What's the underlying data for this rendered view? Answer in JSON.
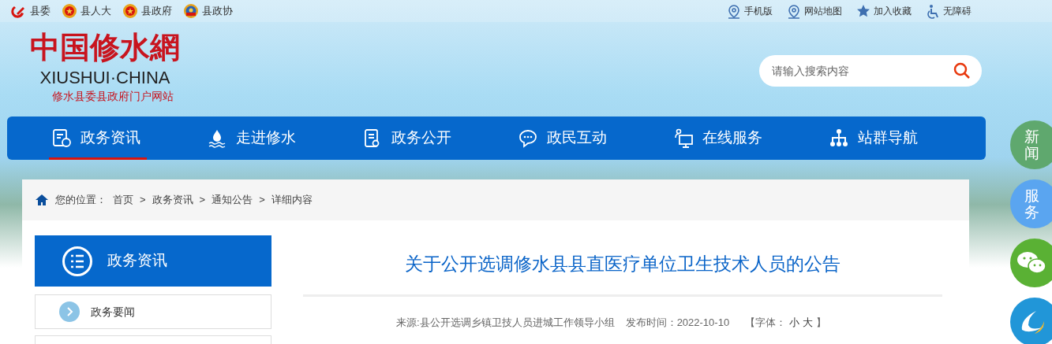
{
  "top_left_links": [
    {
      "label": "县委",
      "kind": "party"
    },
    {
      "label": "县人大",
      "kind": "emblem"
    },
    {
      "label": "县政府",
      "kind": "emblem"
    },
    {
      "label": "县政协",
      "kind": "cppcc"
    }
  ],
  "top_right_links": [
    {
      "label": "手机版",
      "kind": "pin"
    },
    {
      "label": "网站地图",
      "kind": "pin"
    },
    {
      "label": "加入收藏",
      "kind": "star"
    },
    {
      "label": "无障碍",
      "kind": "wheelchair"
    }
  ],
  "logo": {
    "title": "中国修水網",
    "english": "XIUSHUI·CHINA",
    "subtitle": "修水县委县政府门户网站"
  },
  "search": {
    "placeholder": "请输入搜索内容"
  },
  "nav": [
    {
      "label": "政务资讯",
      "selected": true
    },
    {
      "label": "走进修水",
      "selected": false
    },
    {
      "label": "政务公开",
      "selected": false
    },
    {
      "label": "政民互动",
      "selected": false
    },
    {
      "label": "在线服务",
      "selected": false
    },
    {
      "label": "站群导航",
      "selected": false
    }
  ],
  "breadcrumb": {
    "label": "您的位置：",
    "items": [
      "首页",
      ">",
      "政务资讯",
      ">",
      "通知公告",
      ">",
      "详细内容"
    ]
  },
  "sidebar": {
    "title": "政务资讯",
    "items": [
      {
        "label": "政务要闻"
      }
    ]
  },
  "article": {
    "title": "关于公开选调修水县县直医疗单位卫生技术人员的公告",
    "source": "来源:县公开选调乡镇卫技人员进城工作领导小组",
    "date": "发布时间：2022-10-10",
    "font_open": "【字体：",
    "font_small": "小",
    "font_large": "大",
    "font_close": "】"
  },
  "float_buttons": [
    {
      "kind": "text",
      "label": "新闻",
      "color": "#5fa86e"
    },
    {
      "kind": "text",
      "label": "服务",
      "color": "#5aa5f0"
    },
    {
      "kind": "wechat",
      "color": "#5ab134"
    },
    {
      "kind": "app",
      "color": "#2196d8"
    }
  ]
}
